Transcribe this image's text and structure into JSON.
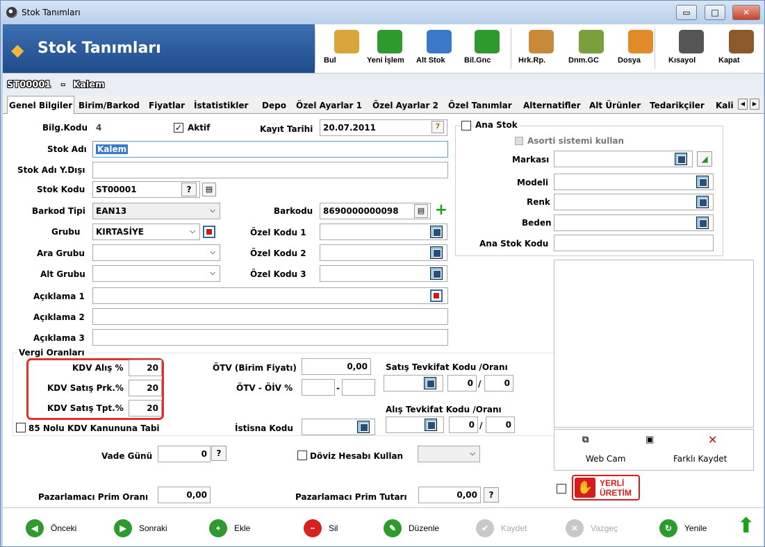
{
  "window": {
    "title": "Stok Tanımları"
  },
  "header": {
    "title": "Stok Tanımları",
    "toolbar": [
      {
        "label": "Bul",
        "icon": "search-icon"
      },
      {
        "label": "Yeni İşlem",
        "icon": "new-icon"
      },
      {
        "label": "Alt Stok",
        "icon": "substock-icon"
      },
      {
        "label": "Bil.Gnc",
        "icon": "update-icon"
      },
      {
        "label": "Hrk.Rp.",
        "icon": "report-icon"
      },
      {
        "label": "Dnm.GC",
        "icon": "period-icon"
      },
      {
        "label": "Dosya",
        "icon": "folder-icon"
      },
      {
        "label": "Kısayol",
        "icon": "shortcut-icon"
      },
      {
        "label": "Kapat",
        "icon": "close-door-icon"
      }
    ]
  },
  "record": {
    "code": "ST00001",
    "sep": "-",
    "name": "Kalem"
  },
  "tabs": [
    "Genel Bilgiler",
    "Birim/Barkod",
    "Fiyatlar",
    "İstatistikler",
    "Depo",
    "Özel Ayarlar 1",
    "Özel Ayarlar 2",
    "Özel Tanımlar",
    "Alternatifler",
    "Alt Ürünler",
    "Tedarikçiler",
    "Kali"
  ],
  "form": {
    "bilg_kodu_label": "Bilg.Kodu",
    "bilg_kodu_value": "4",
    "aktif_label": "Aktif",
    "kayit_tarihi_label": "Kayıt Tarihi",
    "kayit_tarihi_value": "20.07.2011",
    "stok_adi_label": "Stok Adı",
    "stok_adi_value": "Kalem",
    "stok_adi_ydisi_label": "Stok Adı Y.Dışı",
    "stok_adi_ydisi_value": "",
    "stok_kodu_label": "Stok Kodu",
    "stok_kodu_value": "ST00001",
    "stok_kodu_help": "?",
    "barkod_tipi_label": "Barkod Tipi",
    "barkod_tipi_value": "EAN13",
    "barkodu_label": "Barkodu",
    "barkodu_value": "8690000000098",
    "grubu_label": "Grubu",
    "grubu_value": "KIRTASİYE",
    "ara_grubu_label": "Ara Grubu",
    "ara_grubu_value": "",
    "alt_grubu_label": "Alt Grubu",
    "alt_grubu_value": "",
    "ozel_kodu_1_label": "Özel Kodu 1",
    "ozel_kodu_2_label": "Özel Kodu 2",
    "ozel_kodu_3_label": "Özel Kodu 3",
    "aciklama_1_label": "Açıklama 1",
    "aciklama_2_label": "Açıklama 2",
    "aciklama_3_label": "Açıklama 3"
  },
  "ana_stok": {
    "label": "Ana Stok",
    "asorti_label": "Asorti sistemi kullan",
    "markasi_label": "Markası",
    "modeli_label": "Modeli",
    "renk_label": "Renk",
    "beden_label": "Beden",
    "ana_stok_kodu_label": "Ana Stok Kodu"
  },
  "vergi": {
    "title": "Vergi Oranları",
    "kdv_alis_label": "KDV Alış %",
    "kdv_alis_value": "20",
    "kdv_satis_prk_label": "KDV Satış Prk.%",
    "kdv_satis_prk_value": "20",
    "kdv_satis_tpt_label": "KDV Satış Tpt.%",
    "kdv_satis_tpt_value": "20",
    "kanun_label": "85 Nolu KDV Kanununa Tabi",
    "otv_birim_label": "ÖTV (Birim Fiyatı)",
    "otv_birim_value": "0,00",
    "otv_oiv_label": "ÖTV - ÖİV %",
    "otv_oiv_dash": "-",
    "istisna_label": "İstisna Kodu",
    "satis_tevkifat_label": "Satış Tevkifat Kodu /Oranı",
    "satis_tevkifat_pay": "0",
    "satis_tevkifat_payda": "0",
    "alis_tevkifat_label": "Alış Tevkifat Kodu /Oranı",
    "alis_tevkifat_pay": "0",
    "alis_tevkifat_payda": "0",
    "slash": "/"
  },
  "misc": {
    "vade_label": "Vade Günü",
    "vade_value": "0",
    "help": "?",
    "doviz_label": "Döviz Hesabı Kullan",
    "prim_orani_label": "Pazarlamacı Prim Oranı",
    "prim_orani_value": "0,00",
    "prim_tutari_label": "Pazarlamacı Prim Tutarı",
    "prim_tutari_value": "0,00"
  },
  "image_panel": {
    "webcam_label": "Web Cam",
    "save_as_label": "Farklı Kaydet"
  },
  "yerli": {
    "line1": "YERLİ",
    "line2": "ÜRETİM"
  },
  "footer": [
    {
      "label": "Önceki",
      "enabled": true,
      "color": "#2e9a2e"
    },
    {
      "label": "Sonraki",
      "enabled": true,
      "color": "#2e9a2e"
    },
    {
      "label": "Ekle",
      "enabled": true,
      "color": "#2e9a2e"
    },
    {
      "label": "Sil",
      "enabled": true,
      "color": "#d92020"
    },
    {
      "label": "Düzenle",
      "enabled": true,
      "color": "#2e9a2e"
    },
    {
      "label": "Kaydet",
      "enabled": false,
      "color": "#c8c8c8"
    },
    {
      "label": "Vazgeç",
      "enabled": false,
      "color": "#c8c8c8"
    },
    {
      "label": "Yenile",
      "enabled": true,
      "color": "#2e9a2e"
    }
  ]
}
